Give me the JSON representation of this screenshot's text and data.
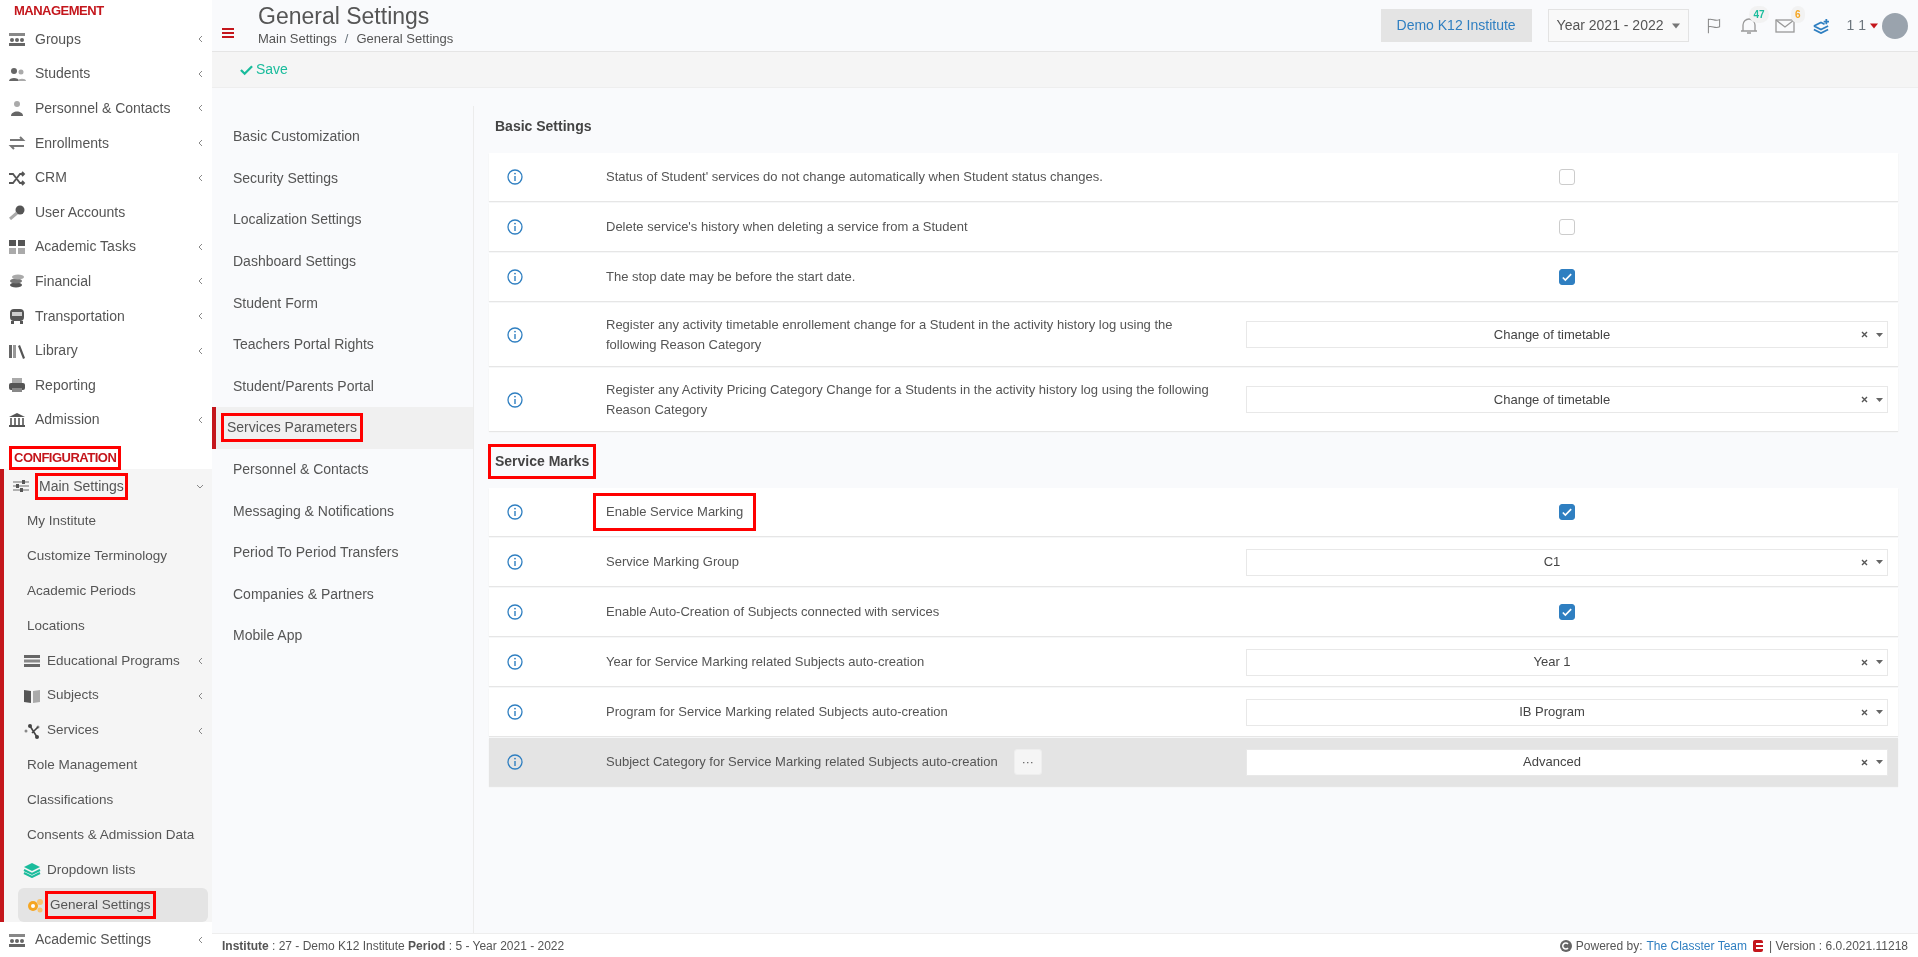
{
  "sidebar": {
    "sections": [
      {
        "title": "MANAGEMENT",
        "highlighted": false,
        "items": [
          {
            "label": "Groups",
            "expandable": true,
            "highlighted": false
          },
          {
            "label": "Students",
            "expandable": true,
            "highlighted": false
          },
          {
            "label": "Personnel & Contacts",
            "expandable": true,
            "highlighted": false
          },
          {
            "label": "Enrollments",
            "expandable": true,
            "highlighted": false
          },
          {
            "label": "CRM",
            "expandable": true,
            "highlighted": false
          },
          {
            "label": "User Accounts",
            "expandable": false,
            "highlighted": false
          },
          {
            "label": "Academic Tasks",
            "expandable": true,
            "highlighted": false
          },
          {
            "label": "Financial",
            "expandable": true,
            "highlighted": false
          },
          {
            "label": "Transportation",
            "expandable": true,
            "highlighted": false
          },
          {
            "label": "Library",
            "expandable": true,
            "highlighted": false
          },
          {
            "label": "Reporting",
            "expandable": false,
            "highlighted": false
          },
          {
            "label": "Admission",
            "expandable": true,
            "highlighted": false
          }
        ]
      },
      {
        "title": "CONFIGURATION",
        "highlighted": true,
        "items": [
          {
            "label": "Main Settings",
            "expandable": true,
            "expanded": true,
            "highlighted": true,
            "children": [
              {
                "label": "My Institute",
                "expandable": false,
                "selected": false,
                "highlighted": false
              },
              {
                "label": "Customize Terminology",
                "expandable": false,
                "selected": false,
                "highlighted": false
              },
              {
                "label": "Academic Periods",
                "expandable": false,
                "selected": false,
                "highlighted": false
              },
              {
                "label": "Locations",
                "expandable": false,
                "selected": false,
                "highlighted": false
              },
              {
                "label": "Educational Programs",
                "expandable": true,
                "selected": false,
                "highlighted": false
              },
              {
                "label": "Subjects",
                "expandable": true,
                "selected": false,
                "highlighted": false
              },
              {
                "label": "Services",
                "expandable": true,
                "selected": false,
                "highlighted": false
              },
              {
                "label": "Role Management",
                "expandable": false,
                "selected": false,
                "highlighted": false
              },
              {
                "label": "Classifications",
                "expandable": false,
                "selected": false,
                "highlighted": false
              },
              {
                "label": "Consents & Admission Data",
                "expandable": false,
                "selected": false,
                "highlighted": false
              },
              {
                "label": "Dropdown lists",
                "expandable": false,
                "selected": false,
                "highlighted": false
              },
              {
                "label": "General Settings",
                "expandable": false,
                "selected": true,
                "highlighted": true
              }
            ]
          },
          {
            "label": "Academic Settings",
            "expandable": true,
            "highlighted": false
          }
        ]
      }
    ]
  },
  "header": {
    "title": "General Settings",
    "breadcrumb": [
      "Main Settings",
      "General Settings"
    ],
    "separator": "/",
    "institute": "Demo K12 Institute",
    "year": "Year 2021 - 2022",
    "notifications": "47",
    "messages": "6",
    "user": "1 1"
  },
  "toolbar": {
    "save": "Save"
  },
  "settings_nav": [
    {
      "label": "Basic Customization",
      "selected": false,
      "highlighted": false
    },
    {
      "label": "Security Settings",
      "selected": false,
      "highlighted": false
    },
    {
      "label": "Localization Settings",
      "selected": false,
      "highlighted": false
    },
    {
      "label": "Dashboard Settings",
      "selected": false,
      "highlighted": false
    },
    {
      "label": "Student Form",
      "selected": false,
      "highlighted": false
    },
    {
      "label": "Teachers Portal Rights",
      "selected": false,
      "highlighted": false
    },
    {
      "label": "Student/Parents Portal",
      "selected": false,
      "highlighted": false
    },
    {
      "label": "Services Parameters",
      "selected": true,
      "highlighted": true
    },
    {
      "label": "Personnel & Contacts",
      "selected": false,
      "highlighted": false
    },
    {
      "label": "Messaging & Notifications",
      "selected": false,
      "highlighted": false
    },
    {
      "label": "Period To Period Transfers",
      "selected": false,
      "highlighted": false
    },
    {
      "label": "Companies & Partners",
      "selected": false,
      "highlighted": false
    },
    {
      "label": "Mobile App",
      "selected": false,
      "highlighted": false
    }
  ],
  "sections": [
    {
      "title": "Basic Settings",
      "highlighted": false,
      "rows": [
        {
          "label": "Status of Student' services do not change automatically when Student status changes.",
          "kind": "checkbox",
          "checked": false,
          "highlighted": false,
          "selected": false
        },
        {
          "label": "Delete service's history when deleting a service from a Student",
          "kind": "checkbox",
          "checked": false,
          "highlighted": false,
          "selected": false
        },
        {
          "label": "The stop date may be before the start date.",
          "kind": "checkbox",
          "checked": true,
          "highlighted": false,
          "selected": false
        },
        {
          "label": "Register any activity timetable enrollement change for a Student in the activity history log using the following Reason Category",
          "kind": "select",
          "value": "Change of timetable",
          "highlighted": false,
          "selected": false
        },
        {
          "label": "Register any Activity Pricing Category Change for a Students in the activity history log using the following Reason Category",
          "kind": "select",
          "value": "Change of timetable",
          "highlighted": false,
          "selected": false
        }
      ]
    },
    {
      "title": "Service Marks",
      "highlighted": true,
      "rows": [
        {
          "label": "Enable Service Marking",
          "kind": "checkbox",
          "checked": true,
          "highlighted": true,
          "selected": false
        },
        {
          "label": "Service Marking Group",
          "kind": "select",
          "value": "C1",
          "highlighted": false,
          "selected": false
        },
        {
          "label": "Enable Auto-Creation of Subjects connected with services",
          "kind": "checkbox",
          "checked": true,
          "highlighted": false,
          "selected": false
        },
        {
          "label": "Year for Service Marking related Subjects auto-creation",
          "kind": "select",
          "value": "Year 1",
          "highlighted": false,
          "selected": false
        },
        {
          "label": "Program for Service Marking related Subjects auto-creation",
          "kind": "select",
          "value": "IB Program",
          "highlighted": false,
          "selected": false
        },
        {
          "label": "Subject Category for Service Marking related Subjects auto-creation",
          "kind": "select",
          "value": "Advanced",
          "more": "···",
          "highlighted": false,
          "selected": true
        }
      ]
    }
  ],
  "footer": {
    "info": "**Institute** : 27 - Demo K12 Institute **Period** : 5 - Year 2021 - 2022",
    "powered": "Powered by:",
    "team": "The Classter Team",
    "version": "| Version : 6.0.2021.11218"
  }
}
